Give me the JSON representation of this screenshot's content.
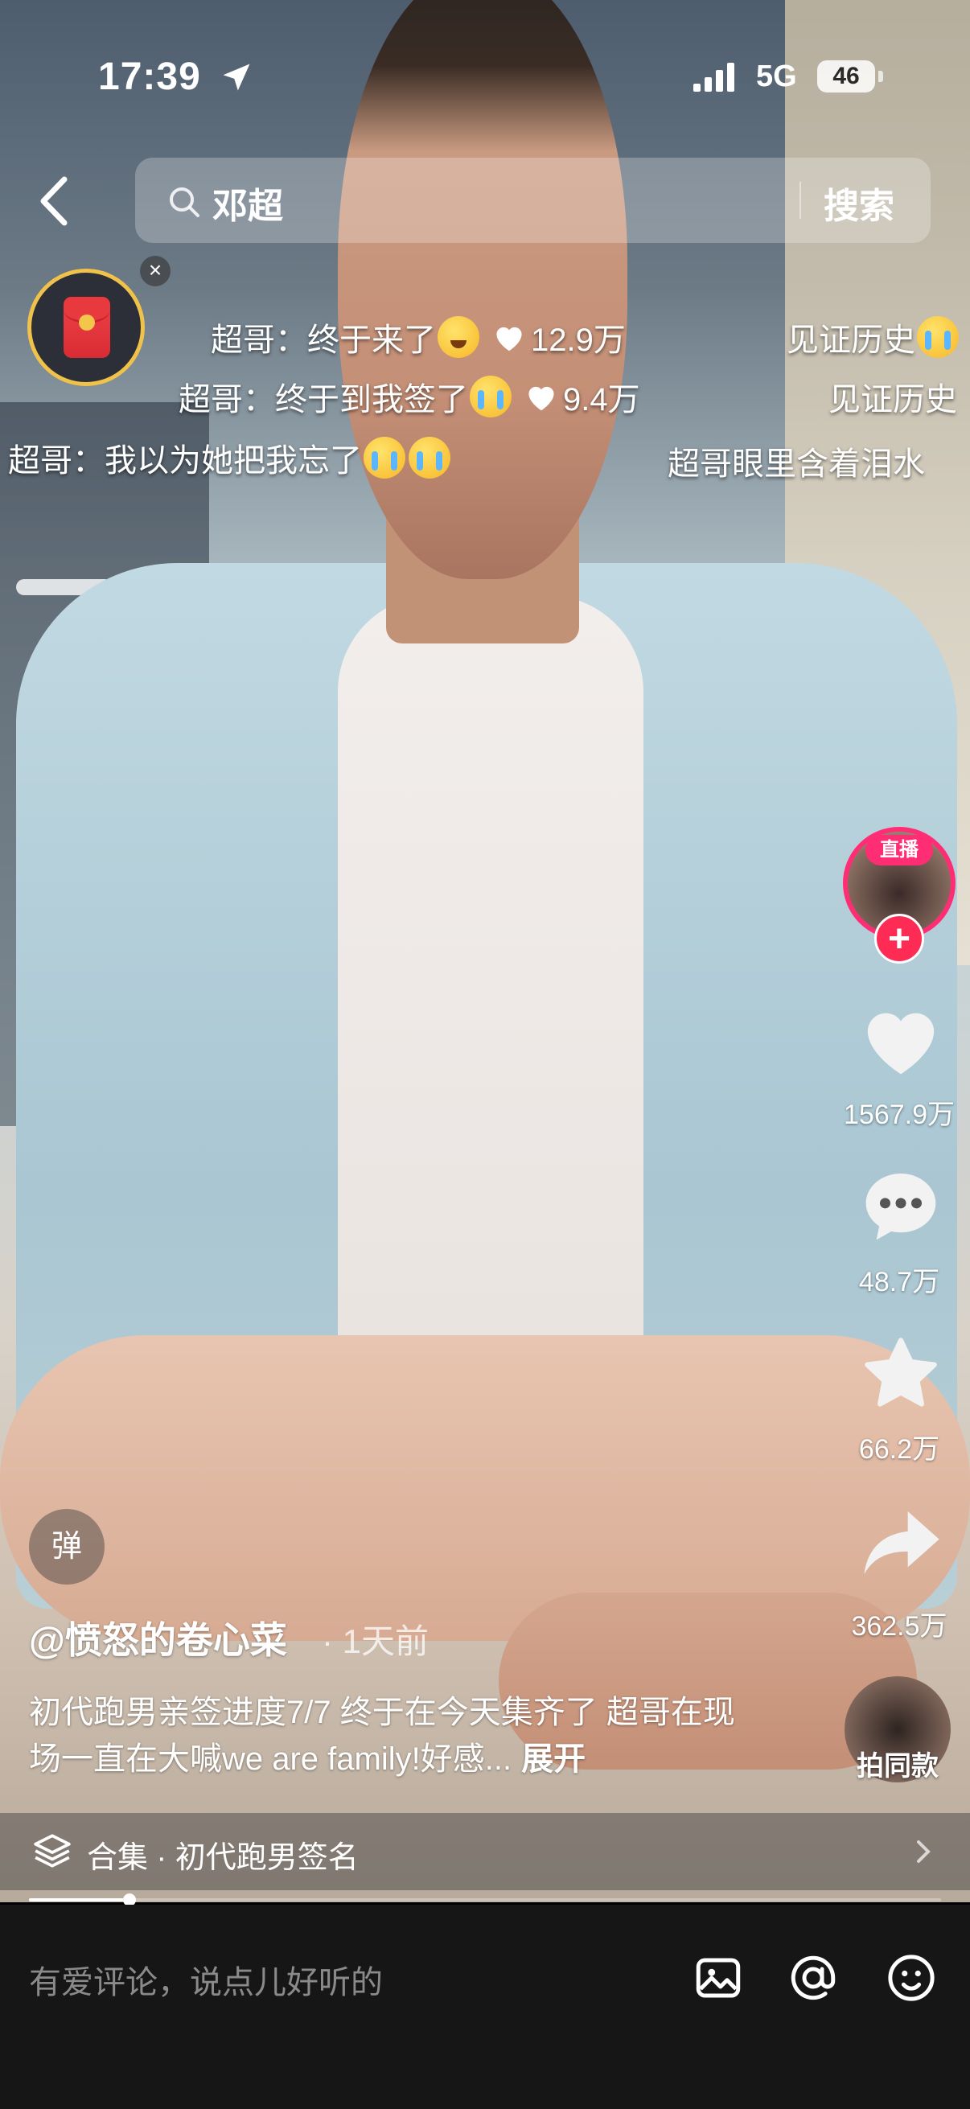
{
  "status_bar": {
    "time": "17:39",
    "network": "5G",
    "battery": "46"
  },
  "search": {
    "query": "邓超",
    "button": "搜索"
  },
  "danmaku": [
    {
      "text": "超哥：终于来了",
      "likes": "12.9万"
    },
    {
      "text": "超哥：终于到我签了",
      "likes": "9.4万"
    },
    {
      "text": "超哥：我以为她把我忘了"
    },
    {
      "text": "见证历史"
    },
    {
      "text": "见证历史"
    },
    {
      "text": "超哥眼里含着泪水"
    }
  ],
  "actions": {
    "live_badge": "直播",
    "likes": "1567.9万",
    "comments": "48.7万",
    "favorites": "66.2万",
    "shares": "362.5万",
    "same_style": "拍同款"
  },
  "danmu_toggle": "弹",
  "post": {
    "author": "@愤怒的卷心菜",
    "time": "· 1天前",
    "description": "初代跑男亲签进度7/7 终于在今天集齐了 超哥在现场一直在大喊we are family!好感...",
    "expand": "展开"
  },
  "collection": {
    "label": "合集 · 初代跑男签名"
  },
  "playback_progress": 0.11,
  "comment_bar": {
    "placeholder": "有爱评论，说点儿好听的"
  },
  "colors": {
    "accent": "#fe2c55",
    "live": "#ff2d74",
    "red_packet_ring": "#f0c24a"
  }
}
